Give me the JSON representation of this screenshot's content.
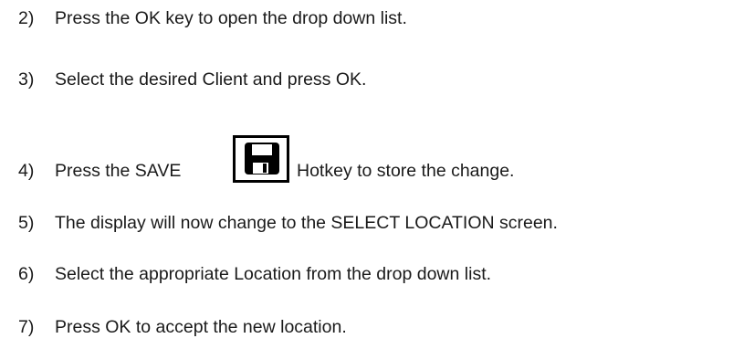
{
  "steps": [
    {
      "num": "2)",
      "text": "Press the OK key to open the drop down list."
    },
    {
      "num": "3)",
      "text": "Select the desired Client and press OK."
    },
    {
      "num": "4)",
      "text_before": "Press the SAVE",
      "text_after": "Hotkey to store the change.",
      "icon": "save-floppy-icon"
    },
    {
      "num": "5)",
      "text": "The display will now change to the SELECT LOCATION screen."
    },
    {
      "num": "6)",
      "text": "Select the appropriate Location from the drop down list."
    },
    {
      "num": "7)",
      "text": "Press OK to accept the new location."
    }
  ]
}
